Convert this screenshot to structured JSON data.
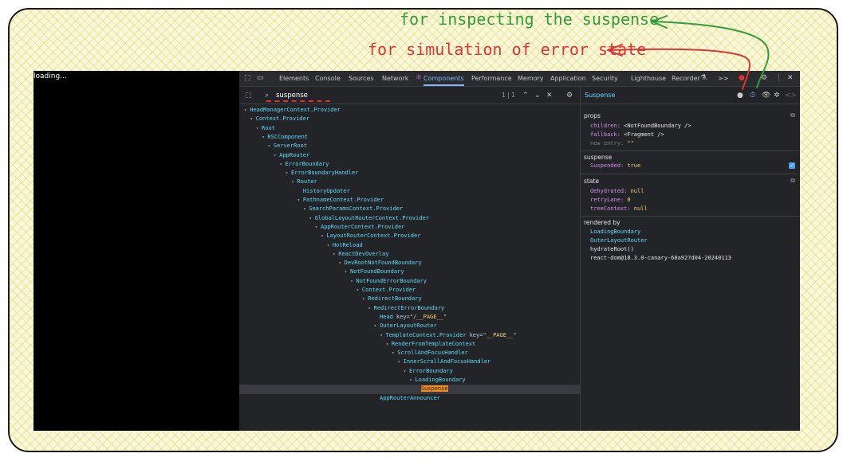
{
  "annotations": {
    "inspect": "for inspecting the suspense",
    "error": "for simulation of error state"
  },
  "page": {
    "loading_text": "loading..."
  },
  "devtools": {
    "tabs": [
      "Elements",
      "Console",
      "Sources",
      "Network",
      "Components",
      "Performance",
      "Memory",
      "Application",
      "Security",
      "Lighthouse",
      "Recorder"
    ],
    "active_tab": "Components",
    "overflow_label": ">>"
  },
  "search": {
    "value": "suspense",
    "count": "1 | 1"
  },
  "tree": [
    {
      "name": "HeadManagerContext.Provider"
    },
    {
      "name": "Context.Provider"
    },
    {
      "name": "Root"
    },
    {
      "name": "RSCComponent"
    },
    {
      "name": "ServerRoot"
    },
    {
      "name": "AppRouter"
    },
    {
      "name": "ErrorBoundary"
    },
    {
      "name": "ErrorBoundaryHandler"
    },
    {
      "name": "Router"
    },
    {
      "name": "HistoryUpdater"
    },
    {
      "name": "PathnameContext.Provider"
    },
    {
      "name": "SearchParamsContext.Provider"
    },
    {
      "name": "GlobalLayoutRouterContext.Provider"
    },
    {
      "name": "AppRouterContext.Provider"
    },
    {
      "name": "LayoutRouterContext.Provider"
    },
    {
      "name": "HotReload"
    },
    {
      "name": "ReactDevOverlay"
    },
    {
      "name": "DevRootNotFoundBoundary"
    },
    {
      "name": "NotFoundBoundary"
    },
    {
      "name": "NotFoundErrorBoundary"
    },
    {
      "name": "Context.Provider"
    },
    {
      "name": "RedirectBoundary"
    },
    {
      "name": "RedirectErrorBoundary"
    },
    {
      "name": "Head",
      "attr_key": "key",
      "attr_val": "\"/__PAGE__\""
    },
    {
      "name": "OuterLayoutRouter"
    },
    {
      "name": "TemplateContext.Provider",
      "attr_key": "key",
      "attr_val": "\"__PAGE__\""
    },
    {
      "name": "RenderFromTemplateContext"
    },
    {
      "name": "ScrollAndFocusHandler"
    },
    {
      "name": "InnerScrollAndFocusHandler"
    },
    {
      "name": "ErrorBoundary"
    },
    {
      "name": "LoadingBoundary"
    },
    {
      "name": "Suspense"
    },
    {
      "name": "AppRouterAnnouncer"
    }
  ],
  "inspector": {
    "component_name": "Suspense",
    "props_title": "props",
    "props": [
      {
        "key": "children",
        "value": "<NotFoundBoundary />"
      },
      {
        "key": "fallback",
        "value": "<Fragment />"
      },
      {
        "key": "new entry",
        "value": "\"\""
      }
    ],
    "suspense_title": "suspense",
    "suspense_key": "Suspended",
    "suspense_value": "true",
    "state_title": "state",
    "state": [
      {
        "key": "dehydrated",
        "value": "null"
      },
      {
        "key": "retryLane",
        "value": "0"
      },
      {
        "key": "treeContext",
        "value": "null"
      }
    ],
    "rendered_by_title": "rendered by",
    "rendered_by": [
      "LoadingBoundary",
      "OuterLayoutRouter",
      "hydrateRoot()",
      "react-dom@18.3.0-canary-60a927d04-20240113"
    ]
  }
}
